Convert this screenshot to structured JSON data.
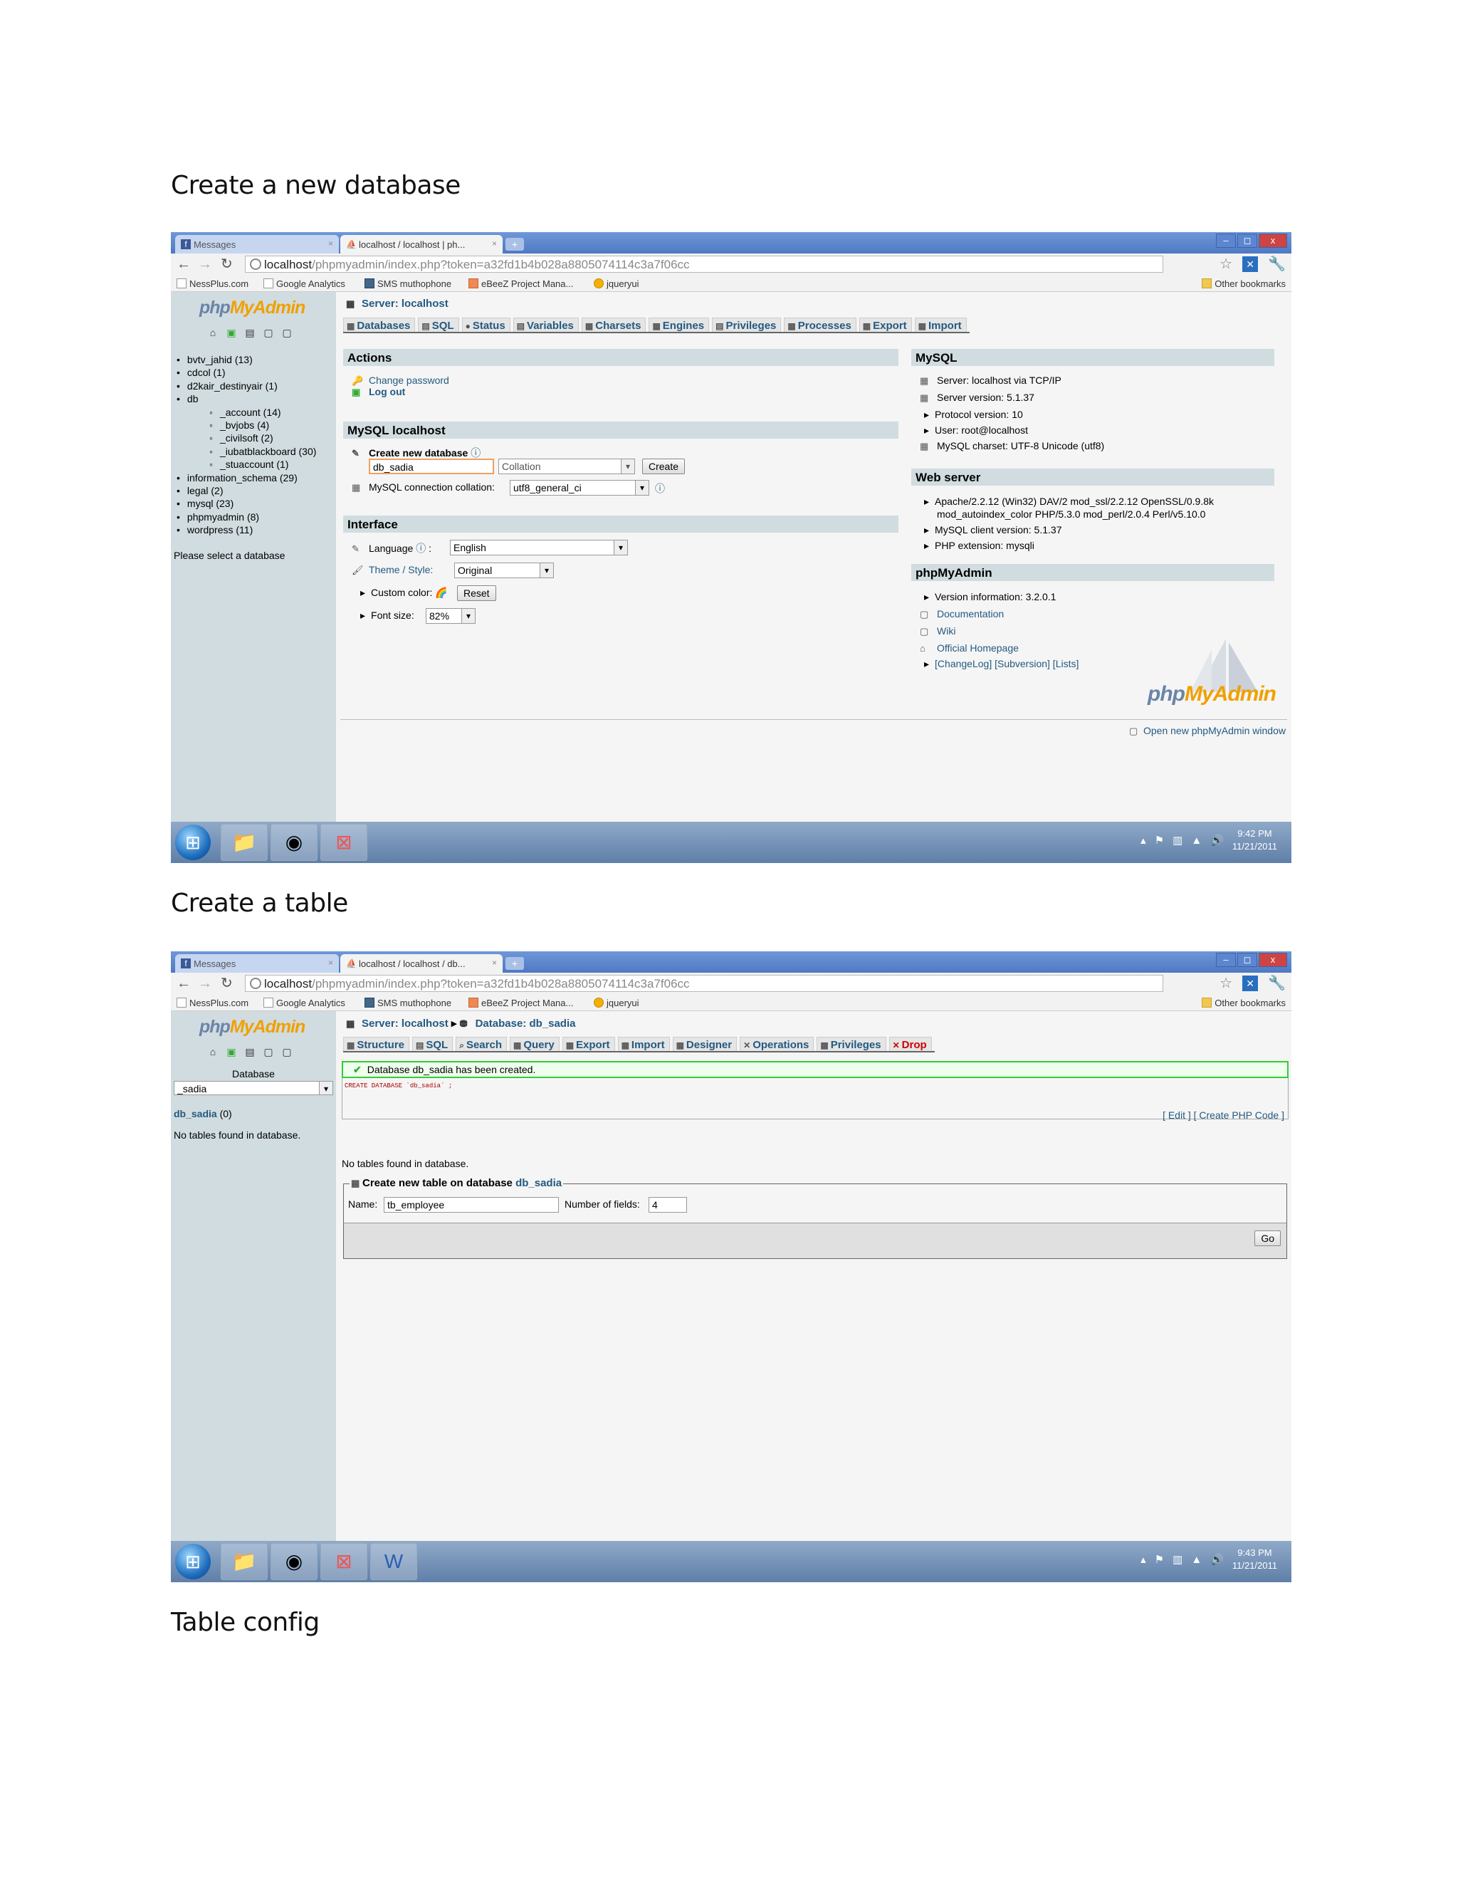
{
  "headings": {
    "h1": "Create a new database",
    "h2": "Create a table",
    "h3": "Table config"
  },
  "browser": {
    "tab_messages": "Messages",
    "tab1_title": "localhost / localhost | ph...",
    "tab2_title": "localhost / localhost / db...",
    "url_host": "localhost",
    "url_path": "/phpmyadmin/index.php?token=a32fd1b4b028a8805074114c3a7f06cc",
    "bookmarks": [
      "NessPlus.com",
      "Google Analytics",
      "SMS muthophone",
      "eBeeZ Project Mana...",
      "jqueryui"
    ],
    "other_bookmarks": "Other bookmarks",
    "win_min": "–",
    "win_max": "◻",
    "win_close": "x"
  },
  "logo": {
    "a": "php",
    "b": "MyAdmin"
  },
  "shot1": {
    "databases": [
      {
        "label": "bvtv_jahid (13)",
        "level": 0
      },
      {
        "label": "cdcol (1)",
        "level": 0
      },
      {
        "label": "d2kair_destinyair (1)",
        "level": 0
      },
      {
        "label": "db",
        "level": 0
      },
      {
        "label": "_account (14)",
        "level": 1
      },
      {
        "label": "_bvjobs (4)",
        "level": 1
      },
      {
        "label": "_civilsoft (2)",
        "level": 1
      },
      {
        "label": "_iubatblackboard (30)",
        "level": 1
      },
      {
        "label": "_stuaccount (1)",
        "level": 1
      },
      {
        "label": "information_schema (29)",
        "level": 0
      },
      {
        "label": "legal (2)",
        "level": 0
      },
      {
        "label": "mysql (23)",
        "level": 0
      },
      {
        "label": "phpmyadmin (8)",
        "level": 0
      },
      {
        "label": "wordpress (11)",
        "level": 0
      }
    ],
    "select_note": "Please select a database",
    "server": "Server: localhost",
    "tabs": [
      "Databases",
      "SQL",
      "Status",
      "Variables",
      "Charsets",
      "Engines",
      "Privileges",
      "Processes",
      "Export",
      "Import"
    ],
    "actions_title": "Actions",
    "change_password": "Change password",
    "log_out": "Log out",
    "mysql_localhost_title": "MySQL localhost",
    "create_db_label": "Create new database",
    "create_db_value": "db_sadia",
    "collation_placeholder": "Collation",
    "create_btn": "Create",
    "conn_collation_label": "MySQL connection collation:",
    "conn_collation_value": "utf8_general_ci",
    "interface_title": "Interface",
    "language_label": "Language",
    "language_value": "English",
    "theme_label": "Theme / Style:",
    "theme_value": "Original",
    "custom_color_label": "Custom color:",
    "reset_btn": "Reset",
    "font_size_label": "Font size:",
    "font_size_value": "82%",
    "mysql_title": "MySQL",
    "mysql_info": [
      "Server: localhost via TCP/IP",
      "Server version: 5.1.37",
      "Protocol version: 10",
      "User: root@localhost",
      "MySQL charset: UTF-8 Unicode (utf8)"
    ],
    "webserver_title": "Web server",
    "web_apache_1": "Apache/2.2.12 (Win32) DAV/2 mod_ssl/2.2.12 OpenSSL/0.9.8k",
    "web_apache_2": "mod_autoindex_color PHP/5.3.0 mod_perl/2.0.4 Perl/v5.10.0",
    "web_client": "MySQL client version: 5.1.37",
    "web_php": "PHP extension: mysqli",
    "pma_title": "phpMyAdmin",
    "pma_version": "Version information: 3.2.0.1",
    "pma_doc": "Documentation",
    "pma_wiki": "Wiki",
    "pma_home": "Official Homepage",
    "pma_links": "[ChangeLog] [Subversion] [Lists]",
    "open_new": "Open new phpMyAdmin window",
    "clock_time": "9:42 PM",
    "clock_date": "11/21/2011"
  },
  "shot2": {
    "server": "Server: localhost",
    "database": "Database: db_sadia",
    "tabs": [
      "Structure",
      "SQL",
      "Search",
      "Query",
      "Export",
      "Import",
      "Designer",
      "Operations",
      "Privileges",
      "Drop"
    ],
    "left_db_label": "Database",
    "left_db_select": "_sadia",
    "left_db_link": "db_sadia",
    "left_db_count": "(0)",
    "left_no_tables": "No tables found in database.",
    "created_msg": "Database db_sadia has been created.",
    "sql_text": "CREATE DATABASE `db_sadia` ;",
    "edit_links": "[ Edit ] [ Create PHP Code ]",
    "no_tables": "No tables found in database.",
    "legend_prefix": "Create new table on database",
    "legend_db": "db_sadia",
    "name_label": "Name:",
    "name_value": "tb_employee",
    "fields_label": "Number of fields:",
    "fields_value": "4",
    "go_btn": "Go",
    "clock_time": "9:43 PM",
    "clock_date": "11/21/2011"
  }
}
